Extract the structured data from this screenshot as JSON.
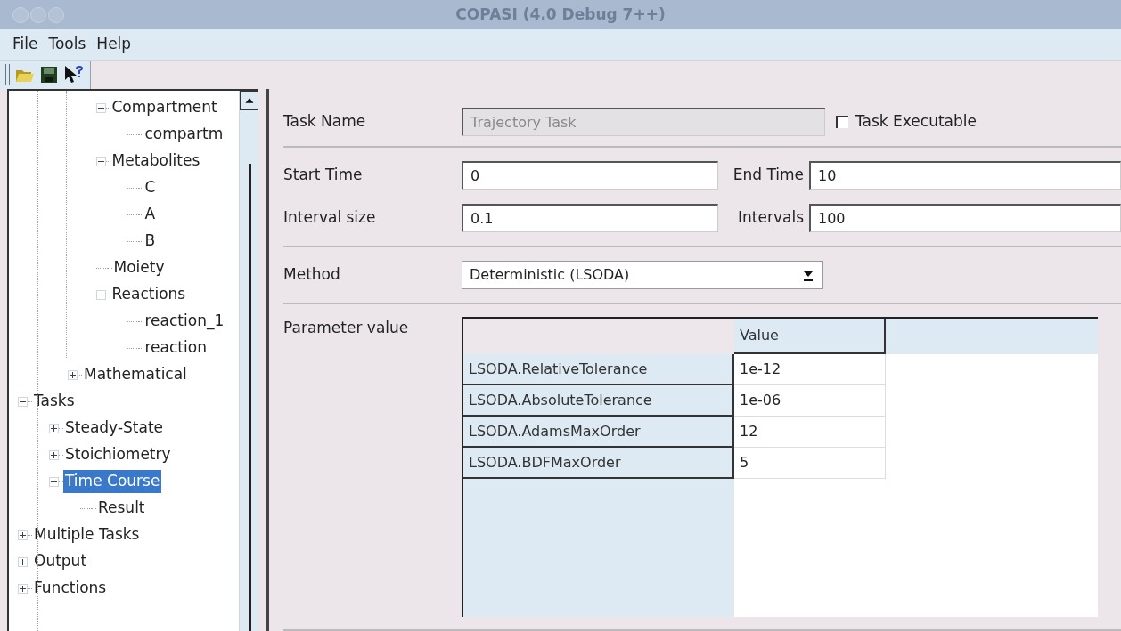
{
  "window": {
    "title": "COPASI (4.0 Debug 7++)"
  },
  "menu": [
    "File",
    "Tools",
    "Help"
  ],
  "tree": {
    "partial_branch": [
      {
        "label": "Compartment",
        "expanded": true,
        "selected": false,
        "children": [
          {
            "label": "compartm",
            "selected": false
          }
        ]
      },
      {
        "label": "Metabolites",
        "expanded": true,
        "selected": false,
        "children": [
          {
            "label": "C",
            "selected": false
          },
          {
            "label": "A",
            "selected": false
          },
          {
            "label": "B",
            "selected": false
          }
        ]
      },
      {
        "label": "Moiety",
        "selected": false
      },
      {
        "label": "Reactions",
        "expanded": true,
        "selected": false,
        "children": [
          {
            "label": "reaction_1",
            "selected": false
          },
          {
            "label": "reaction",
            "selected": false
          }
        ]
      },
      {
        "label": "Mathematical",
        "expanded": false,
        "selected": false
      }
    ],
    "items": [
      {
        "label": "Tasks",
        "expanded": true,
        "selected": false,
        "children": [
          {
            "label": "Steady-State",
            "expanded": false,
            "selected": false
          },
          {
            "label": "Stoichiometry",
            "expanded": false,
            "selected": false
          },
          {
            "label": "Time Course",
            "expanded": true,
            "selected": true,
            "children": [
              {
                "label": "Result",
                "selected": false
              }
            ]
          }
        ]
      },
      {
        "label": "Multiple Tasks",
        "expanded": false,
        "selected": false
      },
      {
        "label": "Output",
        "expanded": false,
        "selected": false
      },
      {
        "label": "Functions",
        "expanded": false,
        "selected": false
      }
    ]
  },
  "task": {
    "name_label": "Task Name",
    "name_value": "Trajectory Task",
    "name_disabled": true,
    "executable_label": "Task Executable",
    "executable": false
  },
  "times": [
    {
      "label": "Start Time",
      "value": "0",
      "label2": "End Time",
      "value2": "10"
    },
    {
      "label": "Interval size",
      "value": "0.1",
      "label2": "Intervals",
      "value2": "100"
    }
  ],
  "method": {
    "label": "Method",
    "value": "Deterministic (LSODA)"
  },
  "parameters": {
    "label": "Parameter value",
    "column": "Value",
    "rows": [
      {
        "name": "LSODA.RelativeTolerance",
        "value": "1e-12"
      },
      {
        "name": "LSODA.AbsoluteTolerance",
        "value": "1e-06"
      },
      {
        "name": "LSODA.AdamsMaxOrder",
        "value": "12"
      },
      {
        "name": "LSODA.BDFMaxOrder",
        "value": "5"
      }
    ]
  }
}
